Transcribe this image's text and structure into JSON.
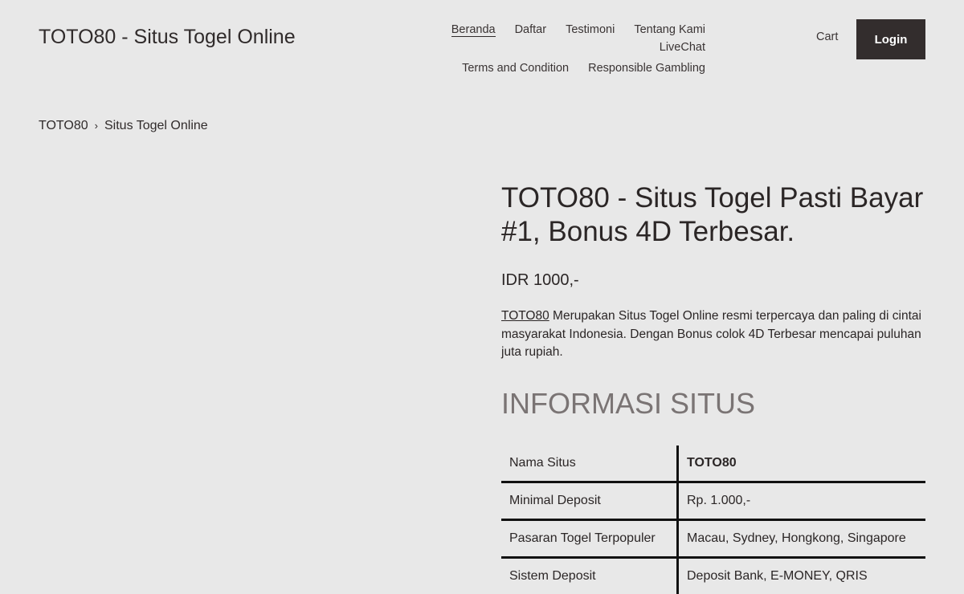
{
  "header": {
    "site_title": "TOTO80 - Situs Togel Online",
    "nav": [
      {
        "label": "Beranda",
        "active": true
      },
      {
        "label": "Daftar",
        "active": false
      },
      {
        "label": "Testimoni",
        "active": false
      },
      {
        "label": "Tentang Kami",
        "active": false
      },
      {
        "label": "LiveChat",
        "active": false
      },
      {
        "label": "Terms and Condition",
        "active": false
      },
      {
        "label": "Responsible Gambling",
        "active": false
      }
    ],
    "cart_label": "Cart",
    "login_label": "Login"
  },
  "breadcrumb": {
    "home": "TOTO80",
    "separator": "›",
    "current": "Situs Togel Online"
  },
  "product": {
    "title": "TOTO80 - Situs Togel Pasti Bayar #1, Bonus 4D Terbesar.",
    "price": "IDR 1000,-",
    "description_link": "TOTO80",
    "description_rest": " Merupakan Situs Togel Online resmi terpercaya dan paling di cintai masyarakat Indonesia. Dengan Bonus colok 4D Terbesar mencapai puluhan juta rupiah."
  },
  "info": {
    "heading": "INFORMASI SITUS",
    "rows": [
      {
        "label": "Nama Situs",
        "value": "TOTO80"
      },
      {
        "label": "Minimal Deposit",
        "value": "Rp. 1.000,-"
      },
      {
        "label": "Pasaran Togel Terpopuler",
        "value": "Macau, Sydney, Hongkong, Singapore"
      },
      {
        "label": "Sistem Deposit",
        "value": "Deposit Bank, E-MONEY, QRIS"
      }
    ]
  },
  "colors": {
    "background": "#e8e8e8",
    "text": "#302b2b",
    "button": "#332d2d",
    "heading_muted": "#7a7474"
  }
}
